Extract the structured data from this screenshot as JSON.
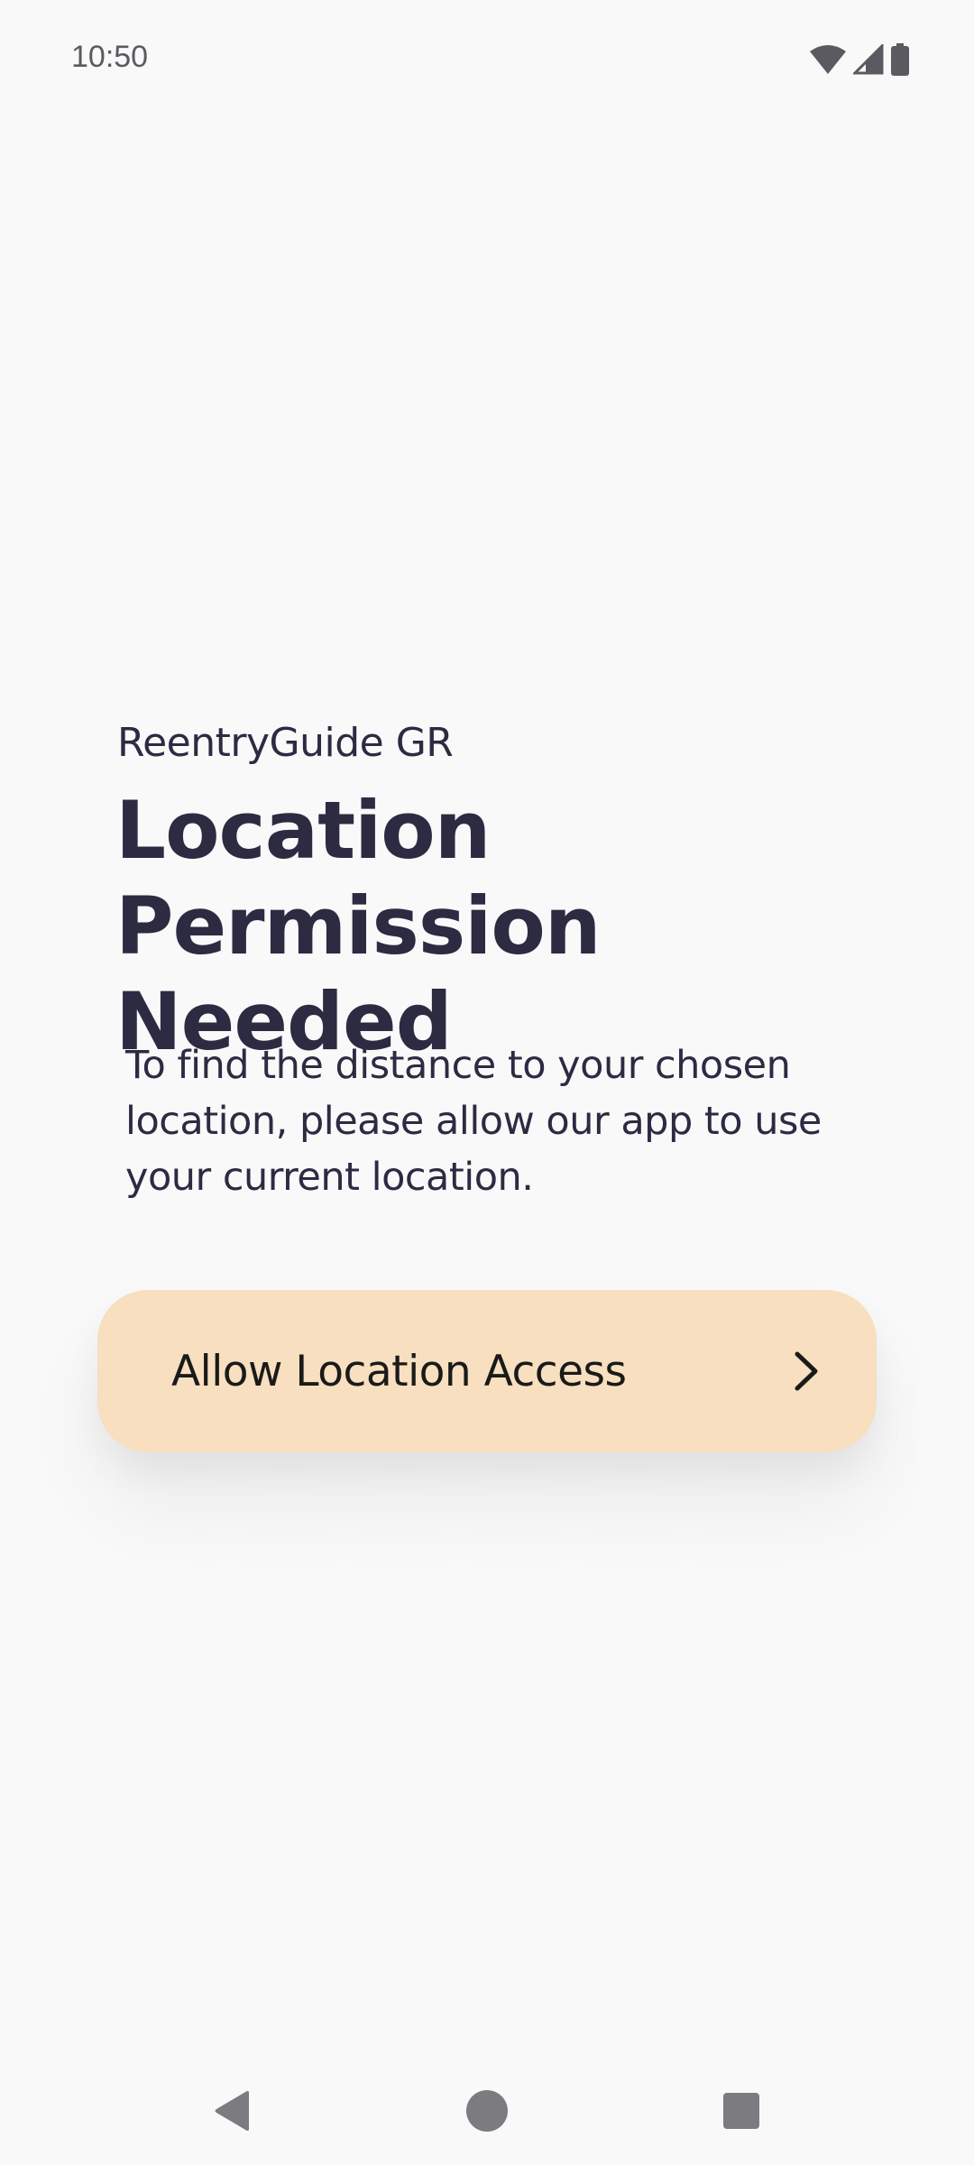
{
  "status_bar": {
    "time": "10:50",
    "icons": [
      "wifi-icon",
      "cellular-signal-icon",
      "battery-icon"
    ]
  },
  "content": {
    "app_name": "ReentryGuide GR",
    "headline_line1": "Location",
    "headline_line2": "Permission Needed",
    "description": "To find the distance to your chosen location, please allow our app to use your current location."
  },
  "button": {
    "label": "Allow Location Access",
    "icon": "chevron-right-icon",
    "background": "#f7dfbf"
  },
  "nav_bar": {
    "buttons": [
      "back-icon",
      "home-icon",
      "recents-icon"
    ]
  },
  "colors": {
    "background": "#f9f9fa",
    "text_primary": "#2c2b42",
    "accent": "#f7dfbf"
  }
}
